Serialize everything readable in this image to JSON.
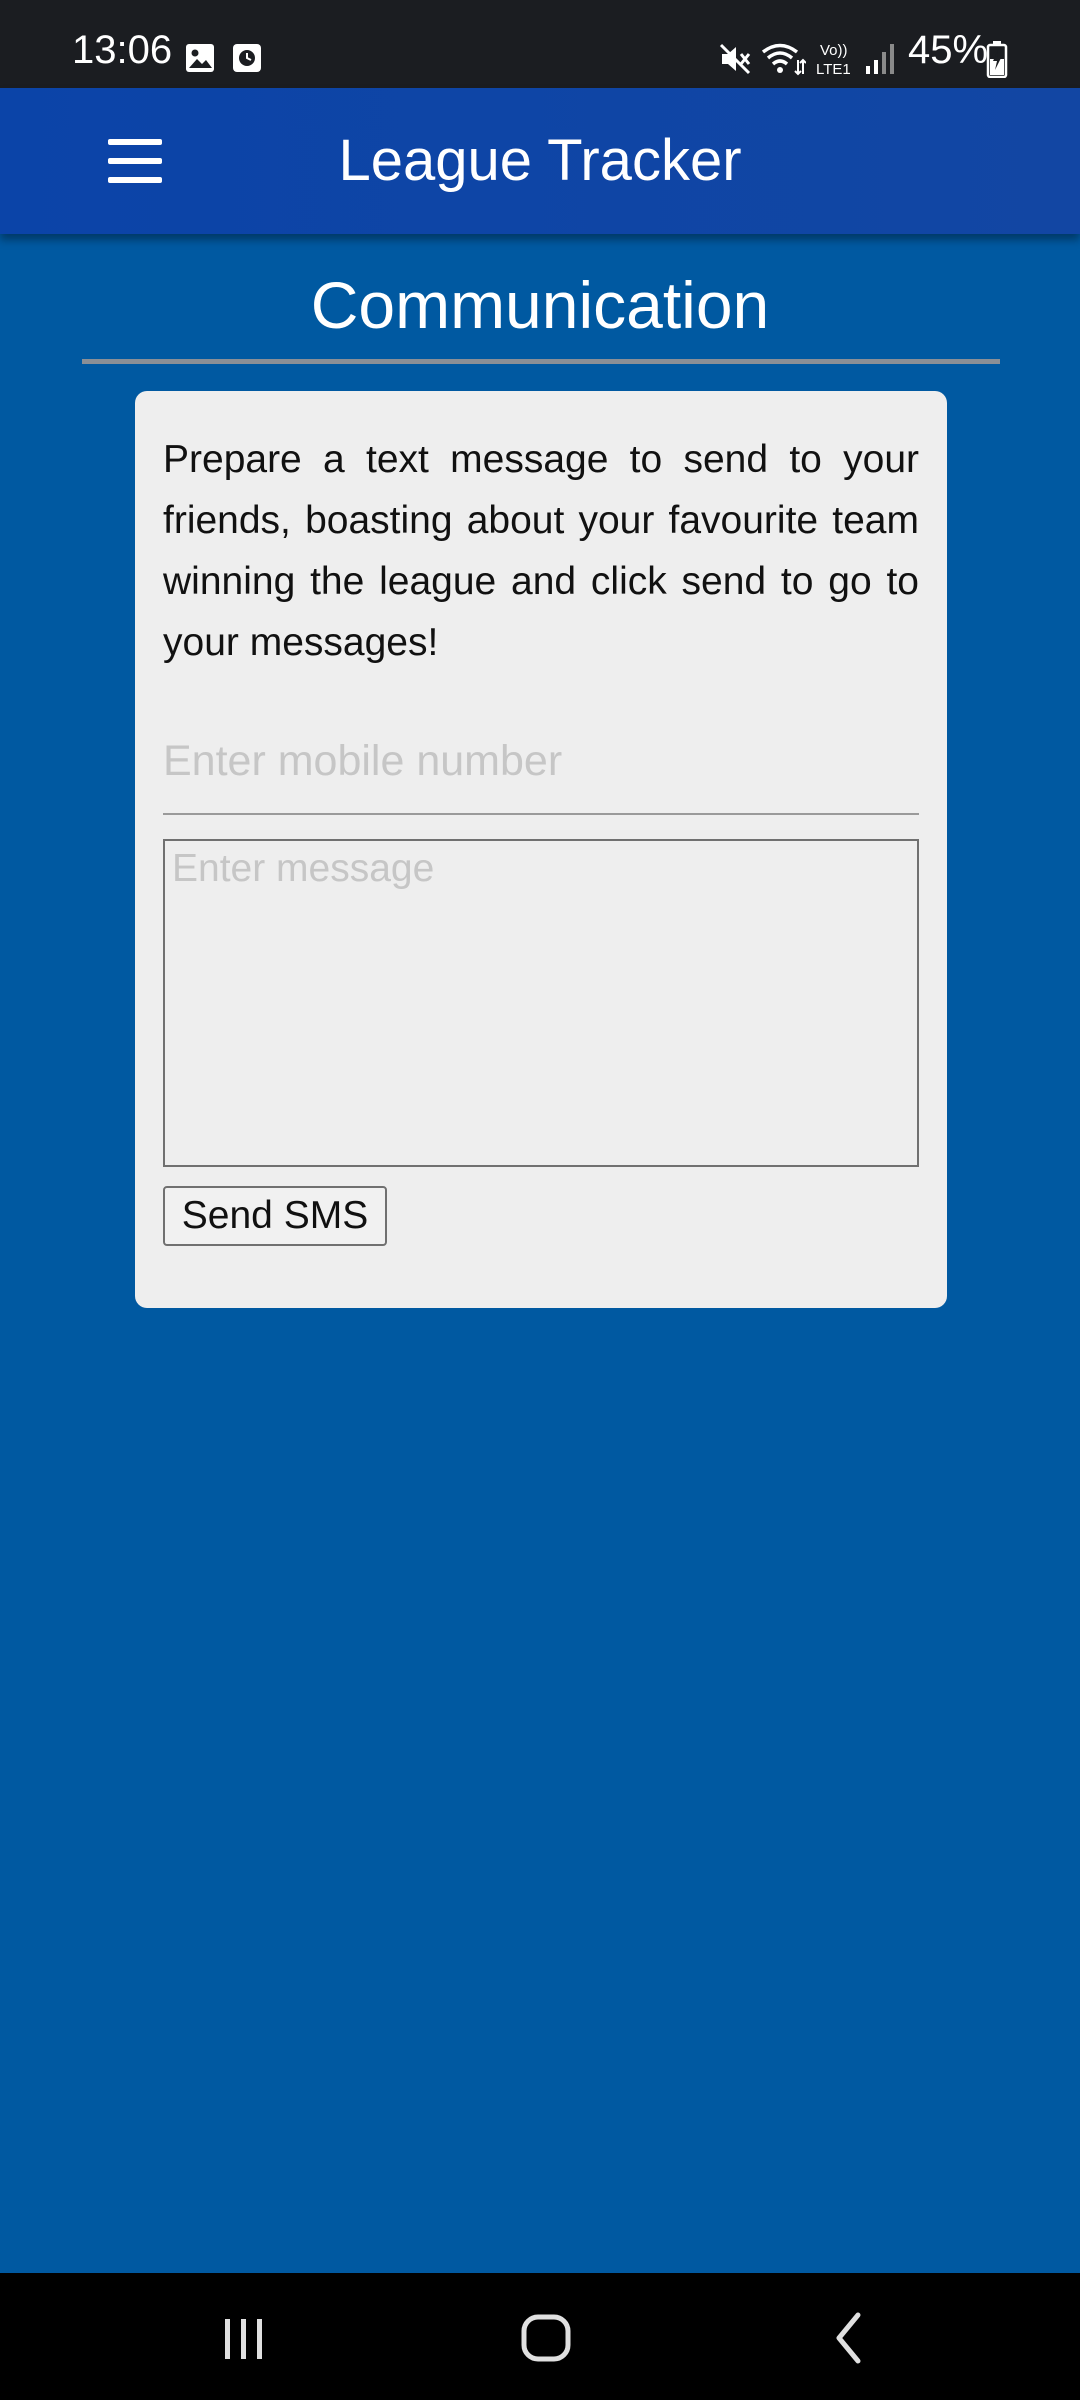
{
  "status_bar": {
    "time": "13:06",
    "battery_percent": "45%",
    "icons": [
      "gallery-icon",
      "clock-icon",
      "mute-icon",
      "wifi-icon",
      "volte-lte1-icon",
      "signal-icon",
      "battery-charging-icon"
    ],
    "volte_label": "Vo))\nLTE1"
  },
  "app_bar": {
    "title": "League Tracker",
    "menu_icon": "hamburger-menu-icon"
  },
  "page": {
    "title": "Communication"
  },
  "card": {
    "intro": "Prepare a text message to send to your friends, boasting about your favourite team winning the league and click send to go to your messages!",
    "mobile_placeholder": "Enter mobile number",
    "mobile_value": "",
    "message_placeholder": "Enter message",
    "message_value": "",
    "send_label": "Send SMS"
  },
  "nav_bar": {
    "buttons": [
      "recent-apps-icon",
      "home-icon",
      "back-icon"
    ]
  },
  "colors": {
    "background": "#0059a1",
    "app_bar": "#0b44a8",
    "status_bar": "#1b1d21",
    "card": "#eeeeee",
    "placeholder": "#c6c6c6"
  }
}
